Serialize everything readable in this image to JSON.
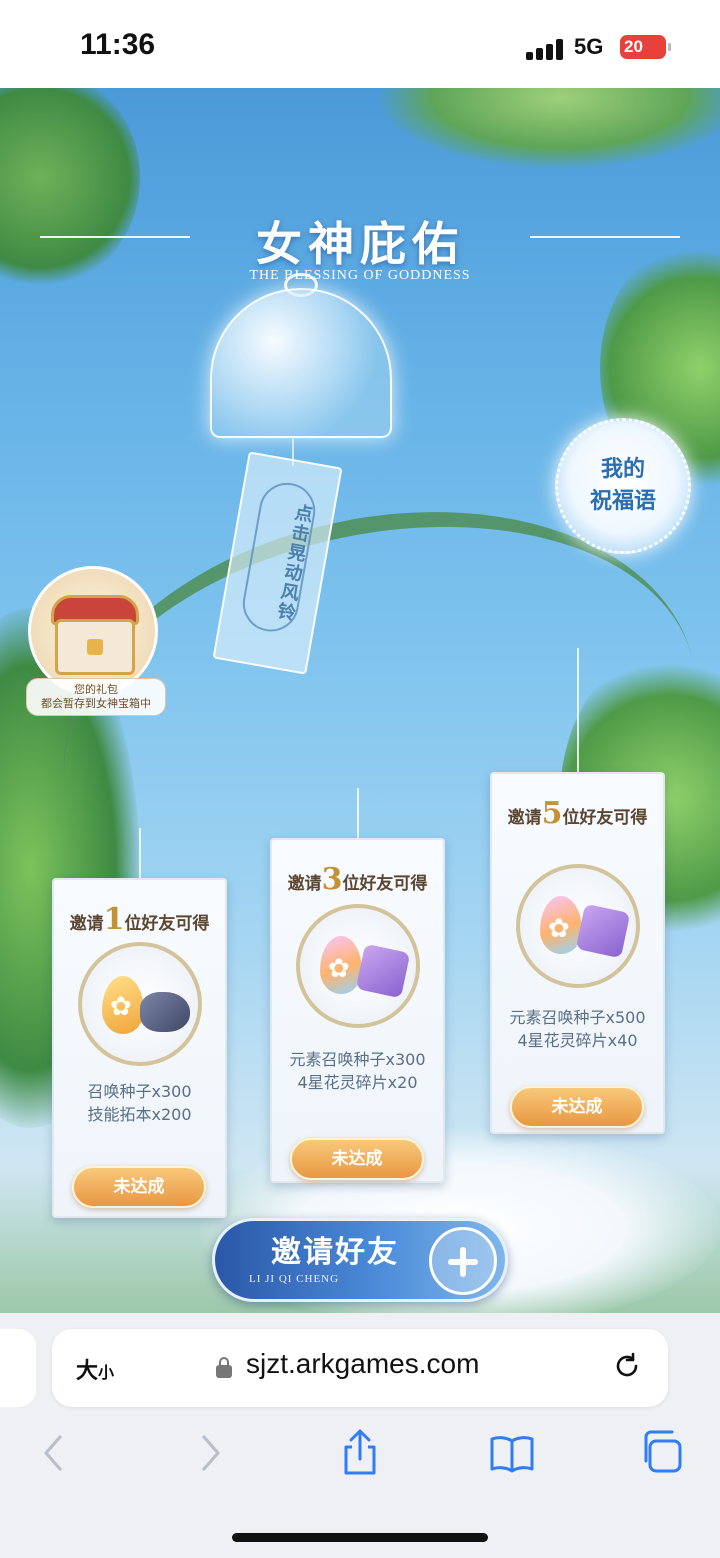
{
  "status_bar": {
    "time": "11:36",
    "network": "5G",
    "battery": "20"
  },
  "game": {
    "title": "女神庇佑",
    "subtitle": "THE BLESSING OF GODDNESS",
    "wind_chime_text": "点击晃动风铃",
    "blessing_button": "我的\n祝福语",
    "gift_caption_line1": "您的礼包",
    "gift_caption_line2": "都会暂存到女神宝箱中",
    "cards": [
      {
        "title_prefix": "邀请",
        "count": "1",
        "title_suffix": "位好友可得",
        "rewards": "召唤种子x300\n技能拓本x200",
        "status": "未达成"
      },
      {
        "title_prefix": "邀请",
        "count": "3",
        "title_suffix": "位好友可得",
        "rewards": "元素召唤种子x300\n4星花灵碎片x20",
        "status": "未达成"
      },
      {
        "title_prefix": "邀请",
        "count": "5",
        "title_suffix": "位好友可得",
        "rewards": "元素召唤种子x500\n4星花灵碎片x40",
        "status": "未达成"
      }
    ],
    "invite_button": "邀请好友",
    "invite_button_sub": "LI JI QI CHENG"
  },
  "browser": {
    "text_size_label": "大",
    "text_size_small": "小",
    "url": "sjzt.arkgames.com"
  },
  "colors": {
    "sky_top": "#4b9ad8",
    "title_gold": "#c49234",
    "status_orange": "#e99742",
    "invite_blue": "#2b57a8",
    "battery_red": "#e8403a"
  },
  "icons": [
    "signal-icon",
    "battery-icon",
    "lock-icon",
    "reload-icon",
    "back-icon",
    "forward-icon",
    "share-icon",
    "bookmarks-icon",
    "tabs-icon",
    "plus-icon"
  ]
}
